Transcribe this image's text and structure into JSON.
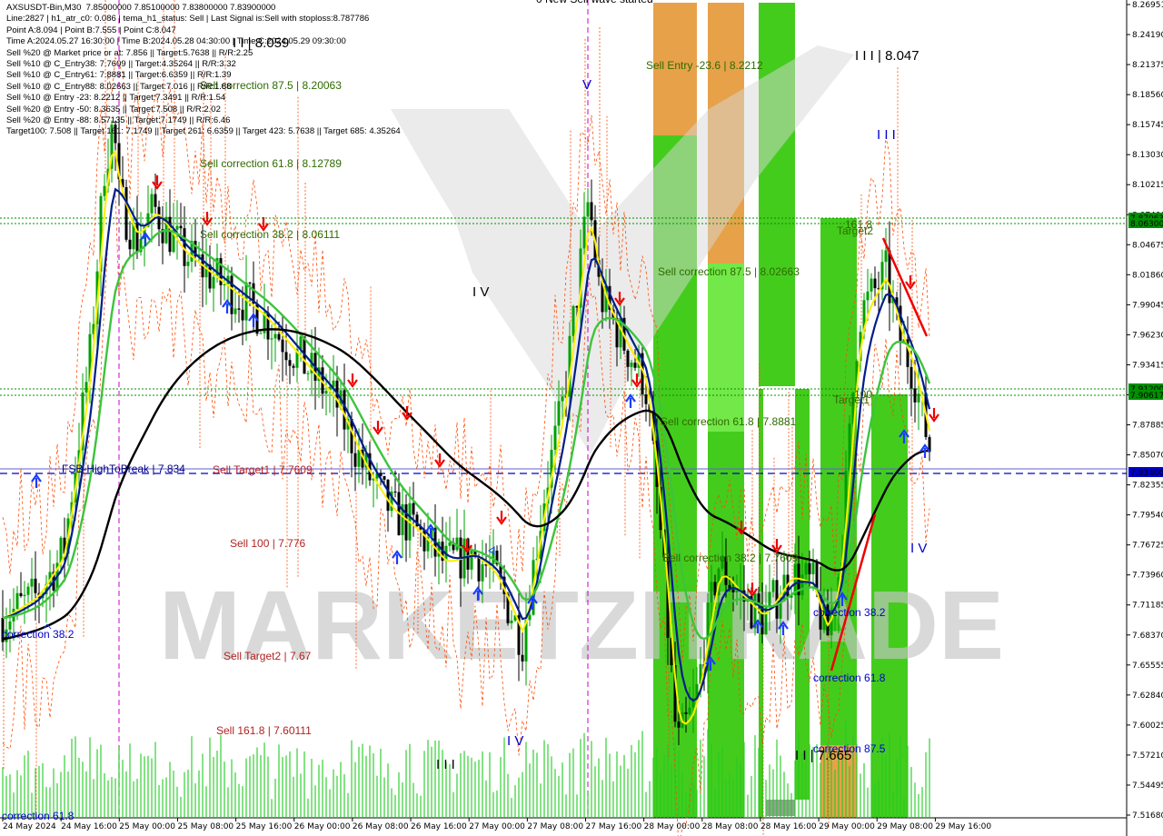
{
  "info_lines": [
    "AXSUSDT-Bin,M30  7.85000000 7.85100000 7.83800000 7.83900000",
    "Line:2827 | h1_atr_c0: 0.086 | tema_h1_status: Sell | Last Signal is:Sell with stoploss:8.787786",
    "Point A:8.094 | Point B:7.555 | Point C:8.047",
    "Time A:2024.05.27 16:30:00 | Time B:2024.05.28 04:30:00 | Time C:2024.05.29 09:30:00",
    "Sell %20 @ Market price or at: 7.856 || Target:5.7638 || R/R:2.25",
    "Sell %10 @ C_Entry38: 7.7609 || Target:4.35264 || R/R:3.32",
    "Sell %10 @ C_Entry61: 7.8881 || Target:6.6359 || R/R:1.39",
    "Sell %10 @ C_Entry88: 8.02663 || Target:7.016 || R/R:1.88",
    "Sell %10 @ Entry -23: 8.2212 || Target:7.3491 || R/R:1.54",
    "Sell %20 @ Entry -50: 8.3635 || Target:7.508 || R/R:2.02",
    "Sell %20 @ Entry -88: 8.57135 || Target:7.1749 || R/R:6.46",
    "Target100: 7.508 || Target 161: 7.1749 || Target 261: 6.6359 || Target 423: 5.7638 || Target 685: 4.35264"
  ],
  "top_partial": "0 New Sell wave started",
  "watermark": "MARKETZITRADE",
  "colors": {
    "bull": "#00a000",
    "bear": "#000000",
    "ma_yellow": "#ffee00",
    "ma_navy": "#001e8a",
    "ma_green": "#3cc43c",
    "ma_black": "#000000",
    "orange": "#ff4a00",
    "green_zone": "#34c80a",
    "green_light": "#66e63a",
    "orange_zone": "#e59a3a",
    "magenta": "#cc00cc",
    "dash_blue": "#0000cc",
    "dot_green": "#009000",
    "label_red": "#b22222",
    "label_green": "#2e7d00",
    "label_blue": "#0000cc"
  },
  "y_axis": {
    "ticks": [
      "8.26951",
      "8.24190",
      "8.21375",
      "8.18560",
      "8.15745",
      "8.13030",
      "8.10215",
      "8.07400",
      "8.04675",
      "8.01860",
      "7.99045",
      "7.96230",
      "7.93415",
      "7.90700",
      "7.87885",
      "7.85070",
      "7.82355",
      "7.79540",
      "7.76725",
      "7.73960",
      "7.71185",
      "7.68370",
      "7.65555",
      "7.62840",
      "7.60025",
      "7.57210",
      "7.54495",
      "7.51680"
    ],
    "marks": [
      {
        "label": "7.87063",
        "sub": "8.06300",
        "price": 8.07063,
        "color": "#009000"
      },
      {
        "label": "7.91200",
        "sub": "7.90617",
        "price": 7.912,
        "color": "#009000"
      },
      {
        "label": "7.83400",
        "price": 7.834,
        "color": "#0000cc"
      }
    ]
  },
  "x_axis": {
    "ticks": [
      "24 May 2024",
      "24 May 16:00",
      "25 May 00:00",
      "25 May 08:00",
      "25 May 16:00",
      "26 May 00:00",
      "26 May 08:00",
      "26 May 16:00",
      "27 May 00:00",
      "27 May 08:00",
      "27 May 16:00",
      "28 May 00:00",
      "28 May 08:00",
      "28 May 16:00",
      "29 May 00:00",
      "29 May 08:00",
      "29 May 16:00"
    ]
  },
  "annotations": {
    "sell_entry_23": "Sell Entry -23.6 | 8.2212",
    "sell_corr_875_a": "Sell correction 87.5 | 8.20063",
    "sell_corr_618_a": "Sell correction 61.8 | 8.12789",
    "sell_corr_382_a": "Sell correction 38.2 | 8.06111",
    "sell_corr_875_b": "Sell correction 87.5 | 8.02663",
    "sell_corr_618_b": "Sell correction 61.8 | 7.8881",
    "sell_corr_382_b": "Sell correction 38.2 | 7.7609",
    "fsb": "FSB-HighToBreak | 7.834",
    "sell_target1": "Sell Target1 | 7.7609",
    "sell_100": "Sell 100 | 7.776",
    "sell_target2": "Sell Target2 | 7.67",
    "sell_1618": "Sell 161.8 | 7.60111",
    "corr_382_left": "correction 38.2",
    "corr_618_left": "correction 61.8",
    "corr_382_right": "correction 38.2",
    "corr_618_right": "correction 61.8",
    "corr_875_right": "correction 87.5",
    "target1": "Target1",
    "target2": "Target2",
    "level_1618": "161.8",
    "level_100": "100"
  },
  "waves": {
    "w_8059": "I I | 8.059",
    "w_8047": "I I I | 8.047",
    "w_7665": "I I | 7.665",
    "w_iii_top": "I I I",
    "w_iii_bot": "I I I",
    "w_iv": "I V",
    "w_iv_low": "I V",
    "w_iv_right": "I V",
    "w_v": "V"
  },
  "chart_data": {
    "type": "candlestick",
    "symbol": "AXSUSDT-Bin",
    "timeframe": "M30",
    "ohlc_last": {
      "open": 7.85,
      "high": 7.851,
      "low": 7.838,
      "close": 7.839
    },
    "ylim": [
      7.5168,
      8.26951
    ],
    "price_path": [
      [
        "24 May 2024",
        7.7
      ],
      [
        "24 May 08:00",
        7.8
      ],
      [
        "24 May 16:00",
        7.98
      ],
      [
        "24 May 22:00",
        8.14
      ],
      [
        "25 May 00:00",
        8.09
      ],
      [
        "25 May 04:00",
        8.08
      ],
      [
        "25 May 08:00",
        8.03
      ],
      [
        "25 May 16:00",
        7.99
      ],
      [
        "26 May 00:00",
        7.92
      ],
      [
        "26 May 08:00",
        7.82
      ],
      [
        "26 May 16:00",
        7.76
      ],
      [
        "27 May 00:00",
        7.72
      ],
      [
        "27 May 04:00",
        7.68
      ],
      [
        "27 May 08:00",
        7.86
      ],
      [
        "27 May 16:30",
        8.094
      ],
      [
        "27 May 20:00",
        7.96
      ],
      [
        "28 May 00:00",
        7.88
      ],
      [
        "28 May 04:30",
        7.555
      ],
      [
        "28 May 08:00",
        7.72
      ],
      [
        "28 May 16:00",
        7.7
      ],
      [
        "29 May 00:00",
        7.68
      ],
      [
        "29 May 04:00",
        7.9
      ],
      [
        "29 May 09:30",
        8.047
      ],
      [
        "29 May 13:00",
        7.85
      ]
    ],
    "levels": {
      "sell_entry_23": 8.2212,
      "sell_corr_875_a": 8.20063,
      "sell_corr_618_a": 8.12789,
      "sell_corr_382_a": 8.06111,
      "sell_corr_875_b": 8.02663,
      "sell_corr_618_b": 7.8881,
      "sell_corr_382_b": 7.7609,
      "fsb": 7.834,
      "sell_target1": 7.7609,
      "sell_100": 7.776,
      "sell_target2": 7.67,
      "sell_1618": 7.60111
    }
  }
}
